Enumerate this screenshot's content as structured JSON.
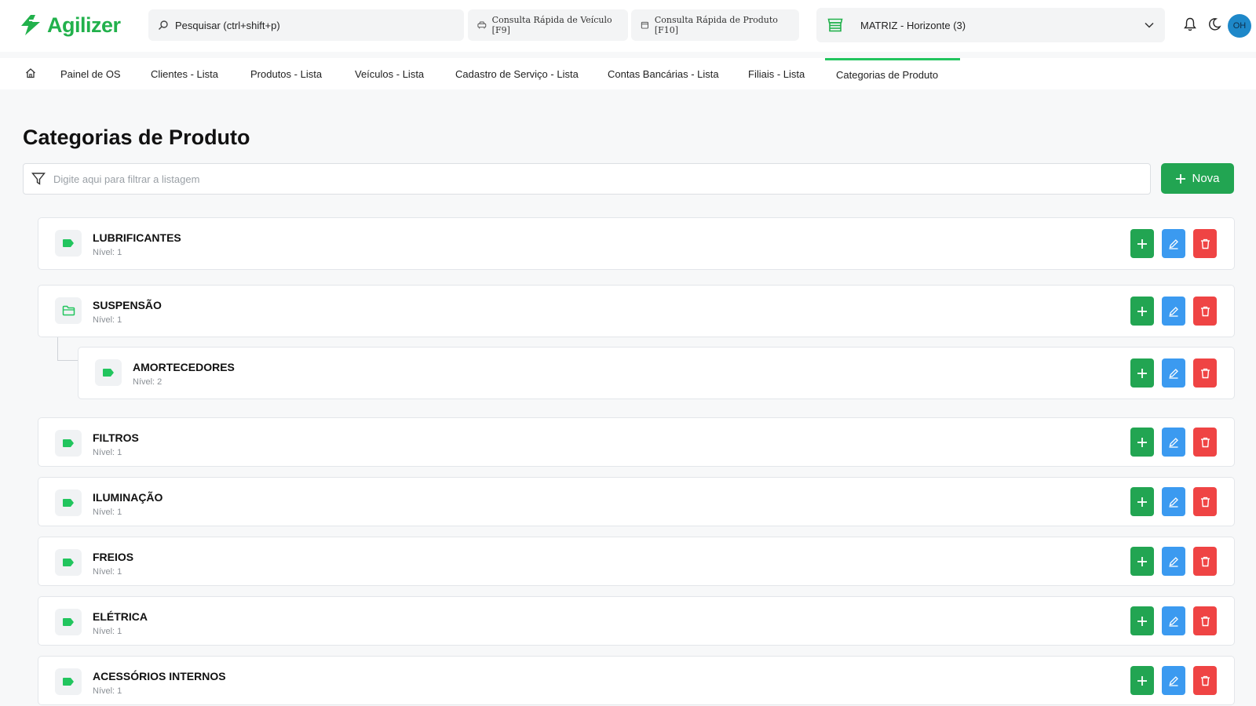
{
  "app": {
    "logo_text": "Agilizer",
    "brand_color": "#22b14c"
  },
  "header": {
    "search_label": "Pesquisar (ctrl+shift+p)",
    "quick_vehicle": "Consulta Rápida de Veículo [F9]",
    "quick_product": "Consulta Rápida de Produto [F10]",
    "branch": "MATRIZ - Horizonte (3)",
    "avatar_initials": "OH"
  },
  "tabs": [
    {
      "label": "Painel de OS"
    },
    {
      "label": "Clientes - Lista"
    },
    {
      "label": "Produtos - Lista"
    },
    {
      "label": "Veículos - Lista"
    },
    {
      "label": "Cadastro de Serviço - Lista"
    },
    {
      "label": "Contas Bancárias - Lista"
    },
    {
      "label": "Filiais - Lista"
    },
    {
      "label": "Categorias de Produto",
      "active": true
    }
  ],
  "main": {
    "title": "Categorias de Produto",
    "filter_placeholder": "Digite aqui para filtrar a listagem",
    "new_button": "Nova"
  },
  "categories": [
    {
      "name": "LUBRIFICANTES",
      "level": "Nível: 1",
      "icon": "tag-icon"
    },
    {
      "name": "SUSPENSÃO",
      "level": "Nível: 1",
      "icon": "folder-icon"
    },
    {
      "name": "AMORTECEDORES",
      "level": "Nível: 2",
      "icon": "tag-icon"
    },
    {
      "name": "FILTROS",
      "level": "Nível: 1",
      "icon": "tag-icon"
    },
    {
      "name": "ILUMINAÇÃO",
      "level": "Nível: 1",
      "icon": "tag-icon"
    },
    {
      "name": "FREIOS",
      "level": "Nível: 1",
      "icon": "tag-icon"
    },
    {
      "name": "ELÉTRICA",
      "level": "Nível: 1",
      "icon": "tag-icon"
    },
    {
      "name": "ACESSÓRIOS INTERNOS",
      "level": "Nível: 1",
      "icon": "tag-icon"
    }
  ],
  "colors": {
    "accent_green": "#22a552",
    "edit_blue": "#3b9af0",
    "delete_red": "#ef4444",
    "icon_green": "#22c55e"
  }
}
